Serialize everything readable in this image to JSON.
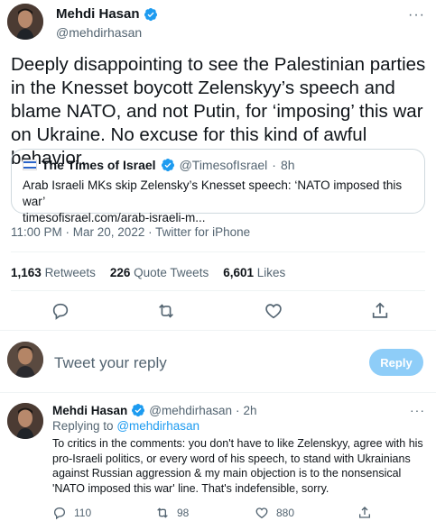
{
  "tweet": {
    "author_name": "Mehdi Hasan",
    "author_handle": "@mehdirhasan",
    "more_label": "···",
    "text": "Deeply disappointing to see the Palestinian parties in the Knesset boycott Zelenskyy’s speech and blame NATO, and not Putin, for ‘imposing’ this war on Ukraine. No excuse for this kind of awful behavior.",
    "timestamp": "11:00 PM · Mar 20, 2022 · Twitter for iPhone"
  },
  "quote": {
    "name": "The Times of Israel",
    "handle": "@TimesofIsrael",
    "dot": "·",
    "time": "8h",
    "line1": "Arab Israeli MKs skip Zelensky’s Knesset speech: ‘NATO imposed this war’",
    "line2": "timesofisrael.com/arab-israeli-m..."
  },
  "stats": {
    "retweets_count": "1,163",
    "retweets_label": "Retweets",
    "quotes_count": "226",
    "quotes_label": "Quote Tweets",
    "likes_count": "6,601",
    "likes_label": "Likes"
  },
  "compose": {
    "placeholder": "Tweet your reply",
    "button": "Reply"
  },
  "reply": {
    "author_name": "Mehdi Hasan",
    "author_handle": "@mehdirhasan",
    "dot": "·",
    "time": "2h",
    "more_label": "···",
    "replying_prefix": "Replying to",
    "replying_handle": "@mehdirhasan",
    "text": "To critics in the comments: you don't have to like Zelenskyy, agree with his pro-Israeli politics, or every word of his speech, to stand with Ukrainians against Russian aggression & my main objection is to the nonsensical 'NATO imposed this war' line. That's indefensible, sorry.",
    "replies": "110",
    "retweets": "98",
    "likes": "880"
  },
  "colors": {
    "accent": "#1d9bf0",
    "secondary_text": "#536471",
    "reply_button_disabled": "#8ecdf8"
  }
}
